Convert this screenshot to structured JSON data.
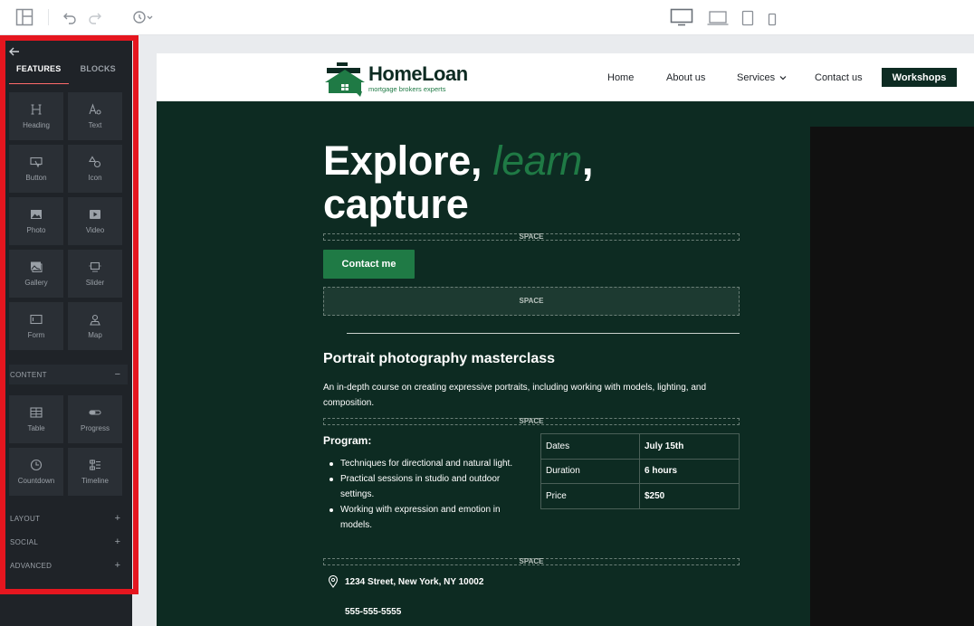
{
  "toolbar": {
    "icons": [
      "layout-icon",
      "undo-icon",
      "redo-icon",
      "history-icon",
      "desktop-icon",
      "laptop-icon",
      "tablet-icon",
      "mobile-icon"
    ]
  },
  "sidebar": {
    "tabs": [
      {
        "label": "FEATURES"
      },
      {
        "label": "BLOCKS"
      }
    ],
    "features": [
      {
        "label": "Heading",
        "icon": "heading-icon"
      },
      {
        "label": "Text",
        "icon": "text-icon"
      },
      {
        "label": "Button",
        "icon": "button-icon"
      },
      {
        "label": "Icon",
        "icon": "shapes-icon"
      },
      {
        "label": "Photo",
        "icon": "photo-icon"
      },
      {
        "label": "Video",
        "icon": "video-icon"
      },
      {
        "label": "Gallery",
        "icon": "gallery-icon"
      },
      {
        "label": "Slider",
        "icon": "slider-icon"
      },
      {
        "label": "Form",
        "icon": "form-icon"
      },
      {
        "label": "Map",
        "icon": "map-icon"
      }
    ],
    "content_section": {
      "label": "CONTENT",
      "symbol": "−"
    },
    "content": [
      {
        "label": "Table",
        "icon": "table-icon"
      },
      {
        "label": "Progress",
        "icon": "progress-icon"
      },
      {
        "label": "Countdown",
        "icon": "countdown-icon"
      },
      {
        "label": "Timeline",
        "icon": "timeline-icon"
      }
    ],
    "sections": [
      {
        "label": "LAYOUT",
        "symbol": "+"
      },
      {
        "label": "SOCIAL",
        "symbol": "+"
      },
      {
        "label": "ADVANCED",
        "symbol": "+"
      }
    ]
  },
  "site": {
    "logo": {
      "title": "HomeLoan",
      "subtitle": "mortgage brokers  experts"
    },
    "nav": [
      {
        "label": "Home"
      },
      {
        "label": "About us"
      },
      {
        "label": "Services",
        "has_dropdown": true
      },
      {
        "label": "Contact us"
      }
    ],
    "nav_button": "Workshops",
    "hero": {
      "title_part1": "Explore, ",
      "title_accent": "learn",
      "title_part2": ",",
      "title_line2": "capture"
    },
    "space_label": "SPACE",
    "cta": "Contact me",
    "masterclass": {
      "title": "Portrait photography masterclass",
      "description": "An in-depth course on creating expressive portraits, including working with models, lighting, and composition."
    },
    "program": {
      "title": "Program:",
      "items": [
        "Techniques for directional and natural light.",
        "Practical sessions in studio and outdoor settings.",
        "Working with expression and emotion in models."
      ]
    },
    "details": [
      {
        "key": "Dates",
        "value": "July 15th"
      },
      {
        "key": "Duration",
        "value": "6 hours"
      },
      {
        "key": "Price",
        "value": "$250"
      }
    ],
    "address": "1234 Street, New York, NY 10002",
    "phone": "555-555-5555"
  },
  "colors": {
    "panel_bg": "#1f2328",
    "tile_bg": "#2a2f35",
    "highlight": "#e5161f",
    "page_bg": "#0d2b22",
    "brand_green": "#1f7a45"
  }
}
